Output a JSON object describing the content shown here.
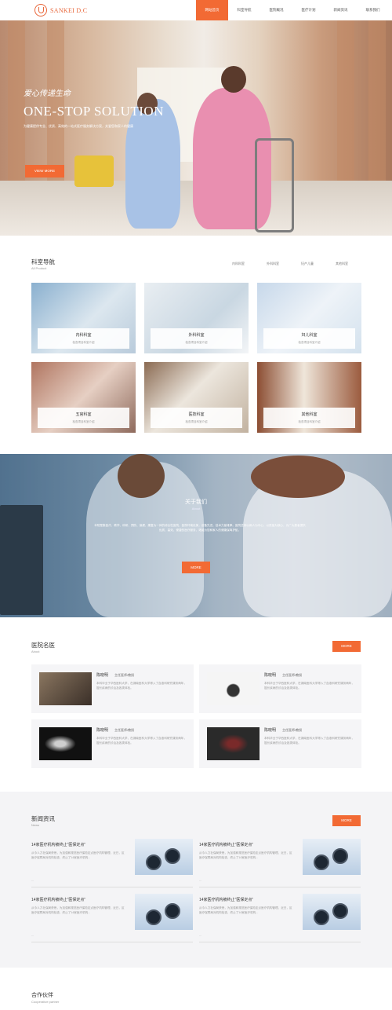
{
  "header": {
    "logo_text": "SANKEI D.C",
    "nav": [
      {
        "label": "网站首页"
      },
      {
        "label": "科室导航"
      },
      {
        "label": "医院概况"
      },
      {
        "label": "医疗计划"
      },
      {
        "label": "新闻资讯"
      },
      {
        "label": "联系我们"
      }
    ]
  },
  "hero": {
    "tagline": "爱心传递生命",
    "title": "ONE-STOP SOLUTION",
    "subtitle": "为健康提供专业、优质、高效的一站式医疗服务解决方案，关爱您和家人的健康",
    "button": "VIEW MORE"
  },
  "departments": {
    "title": "科室导航",
    "subtitle": "All Product",
    "tabs": [
      "内科科室",
      "外科科室",
      "妇产儿童",
      "其他科室"
    ],
    "cards": [
      {
        "name": "内科科室",
        "desc": "检查项目科室介绍"
      },
      {
        "name": "外科科室",
        "desc": "检查项目科室介绍"
      },
      {
        "name": "妇儿科室",
        "desc": "检查项目科室介绍"
      },
      {
        "name": "五官科室",
        "desc": "检查项目科室介绍"
      },
      {
        "name": "医技科室",
        "desc": "检查项目科室介绍"
      },
      {
        "name": "其他科室",
        "desc": "检查项目科室介绍"
      }
    ]
  },
  "about": {
    "title": "关于我们",
    "subtitle": "About",
    "text": "本院是集医疗、教学、科研、预防、保健、康复为一体的综合性医院，医院环境优美，设备先进，技术力量雄厚。医院坚持以病人为中心，以质量为核心，为广大患者提供优质、高效、便捷的医疗服务，竭诚为您和家人的健康保驾护航。",
    "button": "MORE"
  },
  "doctors": {
    "title": "医院名医",
    "subtitle": "About",
    "more": "MORE",
    "items": [
      {
        "name": "陈晓明",
        "role": "主任医师/教授",
        "desc": "本科毕业于华西医科大学，在湖南医科大学得入了血液科研究课务两年，擅长疾病的诊治及各类体检。"
      },
      {
        "name": "陈晓明",
        "role": "主任医师/教授",
        "desc": "本科毕业于华西医科大学，在湖南医科大学得入了血液科研究课务两年，擅长疾病的诊治及各类体检。"
      },
      {
        "name": "陈晓明",
        "role": "主任医师/教授",
        "desc": "本科毕业于华西医科大学，在湖南医科大学得入了血液科研究课务两年，擅长疾病的诊治及各类体检。"
      },
      {
        "name": "陈晓明",
        "role": "主任医师/教授",
        "desc": "本科毕业于华西医科大学，在湖南医科大学得入了血液科研究课务两年，擅长疾病的诊治及各类体检。"
      }
    ]
  },
  "news": {
    "title": "新闻资讯",
    "subtitle": "News",
    "more": "MORE",
    "items": [
      {
        "title": "14家医疗机构被终止\"医保定点\"",
        "desc": "从今人力社保局获悉，为加强和规范医疗保险定点医疗机构管理，近日，区医疗保障局对机构检查，终止了14家医疗机构...",
        "dots": "..."
      },
      {
        "title": "14家医疗机构被终止\"医保定点\"",
        "desc": "从今人力社保局获悉，为加强和规范医疗保险定点医疗机构管理，近日，区医疗保障局对机构检查，终止了14家医疗机构...",
        "dots": "..."
      },
      {
        "title": "14家医疗机构被终止\"医保定点\"",
        "desc": "从今人力社保局获悉，为加强和规范医疗保险定点医疗机构管理，近日，区医疗保障局对机构检查，终止了14家医疗机构...",
        "dots": "..."
      },
      {
        "title": "14家医疗机构被终止\"医保定点\"",
        "desc": "从今人力社保局获悉，为加强和规范医疗保险定点医疗机构管理，近日，区医疗保障局对机构检查，终止了14家医疗机构...",
        "dots": "..."
      }
    ]
  },
  "partners": {
    "title": "合作伙伴",
    "subtitle": "Cooperative partner"
  },
  "colors": {
    "accent": "#f26a34"
  }
}
